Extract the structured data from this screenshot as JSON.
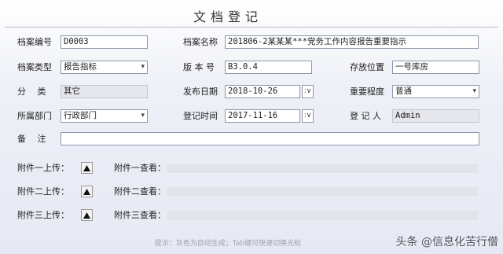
{
  "title": "文档登记",
  "labels": {
    "archive_no": "档案编号",
    "archive_name": "档案名称",
    "archive_type": "档案类型",
    "version": "版 本 号",
    "location": "存放位置",
    "category": "分　 类",
    "publish_date": "发布日期",
    "importance": "重要程度",
    "department": "所属部门",
    "register_time": "登记时间",
    "registrant": "登 记 人",
    "remark": "备　 注",
    "attach1_upload": "附件一上传：",
    "attach1_view": "附件一查看：",
    "attach2_upload": "附件二上传：",
    "attach2_view": "附件二查看：",
    "attach3_upload": "附件三上传：",
    "attach3_view": "附件三查看："
  },
  "values": {
    "archive_no": "D0003",
    "archive_name": "201806-2某某某***党务工作内容报告重要指示",
    "archive_type": "报告指标",
    "version": "B3.0.4",
    "location": "一号库房",
    "category": "其它",
    "publish_date": "2018-10-26",
    "importance": "普通",
    "department": "行政部门",
    "register_time": "2017-11-16",
    "registrant": "Admin",
    "remark": ""
  },
  "hint": "提示：灰色为自动生成；Tab键可快速切换光标",
  "watermark": "头条 @信息化苦行僧"
}
